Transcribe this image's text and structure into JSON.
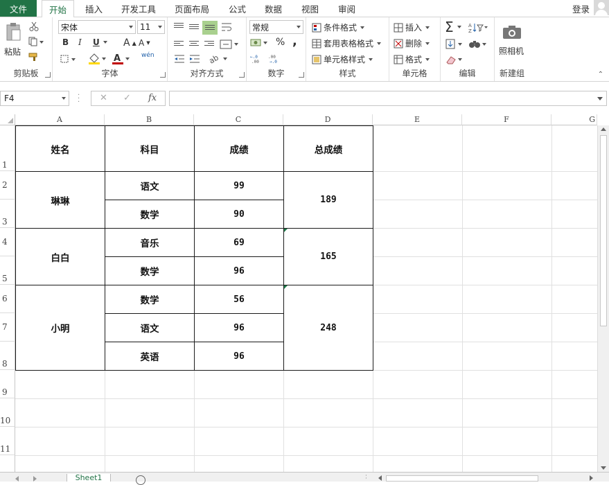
{
  "menu": {
    "file": "文件",
    "tabs": [
      "开始",
      "插入",
      "开发工具",
      "页面布局",
      "公式",
      "数据",
      "视图",
      "审阅"
    ],
    "active_tab": "开始",
    "login": "登录"
  },
  "ribbon": {
    "clipboard": {
      "label": "剪贴板",
      "paste": "粘贴"
    },
    "font": {
      "label": "字体",
      "font_name": "宋体",
      "font_size": "11",
      "bold": "B",
      "italic": "I",
      "underline": "U",
      "grow": "A",
      "shrink": "A",
      "color_letter": "A",
      "phonetic": "wén"
    },
    "alignment": {
      "label": "对齐方式"
    },
    "number": {
      "label": "数字",
      "format": "常规",
      "percent": "%",
      "comma": ","
    },
    "styles": {
      "label": "样式",
      "conditional": "条件格式",
      "table": "套用表格格式",
      "cell_styles": "单元格样式"
    },
    "cells": {
      "label": "单元格",
      "insert": "插入",
      "delete": "删除",
      "format": "格式"
    },
    "editing": {
      "label": "编辑",
      "sum": "Σ"
    },
    "new_group": {
      "label": "新建组",
      "camera": "照相机"
    }
  },
  "formula_bar": {
    "name_box": "F4",
    "cancel": "✕",
    "enter": "✓",
    "fx": "fx",
    "value": ""
  },
  "columns": [
    "A",
    "B",
    "C",
    "D",
    "E",
    "F",
    "G"
  ],
  "rows": [
    "1",
    "2",
    "3",
    "4",
    "5",
    "6",
    "7",
    "8",
    "9",
    "10",
    "11"
  ],
  "table": {
    "headers": {
      "name": "姓名",
      "subject": "科目",
      "score": "成绩",
      "total": "总成绩"
    },
    "students": [
      {
        "name": "琳琳",
        "total": "189",
        "subjects": [
          {
            "subject": "语文",
            "score": "99"
          },
          {
            "subject": "数学",
            "score": "90"
          }
        ]
      },
      {
        "name": "白白",
        "total": "165",
        "subjects": [
          {
            "subject": "音乐",
            "score": "69"
          },
          {
            "subject": "数学",
            "score": "96"
          }
        ]
      },
      {
        "name": "小明",
        "total": "248",
        "subjects": [
          {
            "subject": "数学",
            "score": "56"
          },
          {
            "subject": "语文",
            "score": "96"
          },
          {
            "subject": "英语",
            "score": "96"
          }
        ]
      }
    ]
  },
  "sheet_tab": "Sheet1",
  "colors": {
    "accent": "#217346",
    "error_triangle": "#1d7c4b"
  }
}
